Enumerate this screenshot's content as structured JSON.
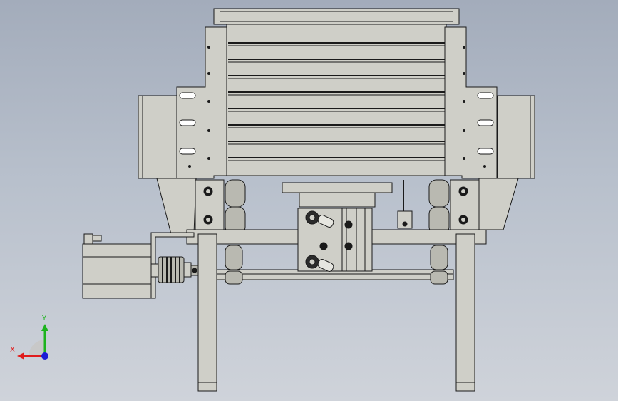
{
  "viewport": {
    "background_top": "#a3acbb",
    "background_bottom": "#cfd3da"
  },
  "model": {
    "part_fill": "#cfcfc8",
    "part_fill_dark": "#b9b9b1",
    "edge_color": "#1a1a1a",
    "fitting_color": "#2b2b2b"
  },
  "triad": {
    "x_label": "X",
    "y_label": "Y",
    "x_color": "#e01b1b",
    "y_color": "#1db31d",
    "z_color": "#1c1cd6",
    "x_icon": "arrow-left-icon",
    "y_icon": "arrow-up-icon",
    "z_icon": "dot-icon"
  }
}
